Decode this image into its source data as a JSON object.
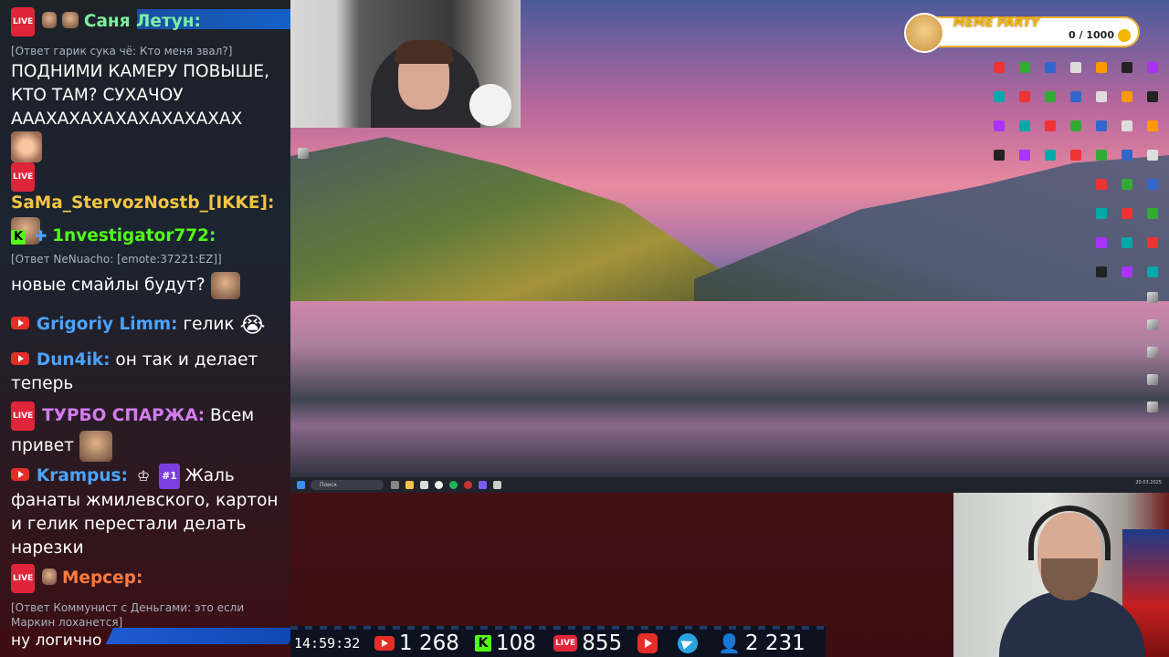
{
  "chat": {
    "messages": [
      {
        "platform": "live",
        "name": "Саня Летун:",
        "name_color": "#7cf0a0",
        "reply": "[Ответ гарик сука чё: Кто меня звал?]",
        "text": "ПОДНИМИ КАМЕРУ ПОВЫШЕ, КТО ТАМ? СУХАЧОУ АААХАХАХАХАХАХАХАХАХ"
      },
      {
        "platform": "live",
        "name": "SaMa_StervozNostb_[IKKE]:",
        "name_color": "#f5c542",
        "text": ""
      },
      {
        "platform": "kick",
        "name": "1nvestigator772:",
        "name_color": "#53fc18",
        "reply": "[Ответ NeNuacho: [emote:37221:EZ]]",
        "text": "новые смайлы будут?"
      },
      {
        "platform": "youtube",
        "name": "Grigoriy Limm:",
        "name_color": "#4aa3ff",
        "text": "гелик"
      },
      {
        "platform": "youtube",
        "name": "Dun4ik:",
        "name_color": "#4aa3ff",
        "text": "он так и делает теперь"
      },
      {
        "platform": "live",
        "name": "ТУРБО СПАРЖА:",
        "name_color": "#d37bf0",
        "text": "Всем привет"
      },
      {
        "platform": "youtube",
        "name": "Krampus:",
        "name_color": "#4aa3ff",
        "sub_badge": "#1",
        "text": "Жаль фанаты жмилевского, картон и гелик перестали делать нарезки"
      },
      {
        "platform": "live",
        "name": "Мерсер:",
        "name_color": "#ff7a3d",
        "reply": "[Ответ Коммунист с Деньгами: это если Маркин лоханется]",
        "text": ""
      }
    ],
    "last_line": "ну логично"
  },
  "screen": {
    "taskbar_search": "Поиск",
    "clock": "20.03.2025"
  },
  "meme_party": {
    "title": "MEME PARTY",
    "progress": "0 / 1000"
  },
  "stats": {
    "time": "14:59:32",
    "youtube_viewers": "1 268",
    "kick_viewers": "108",
    "live_viewers": "855",
    "total_viewers": "2 231"
  },
  "icons": {
    "live_badge": "LIVE",
    "kick_letter": "K"
  }
}
